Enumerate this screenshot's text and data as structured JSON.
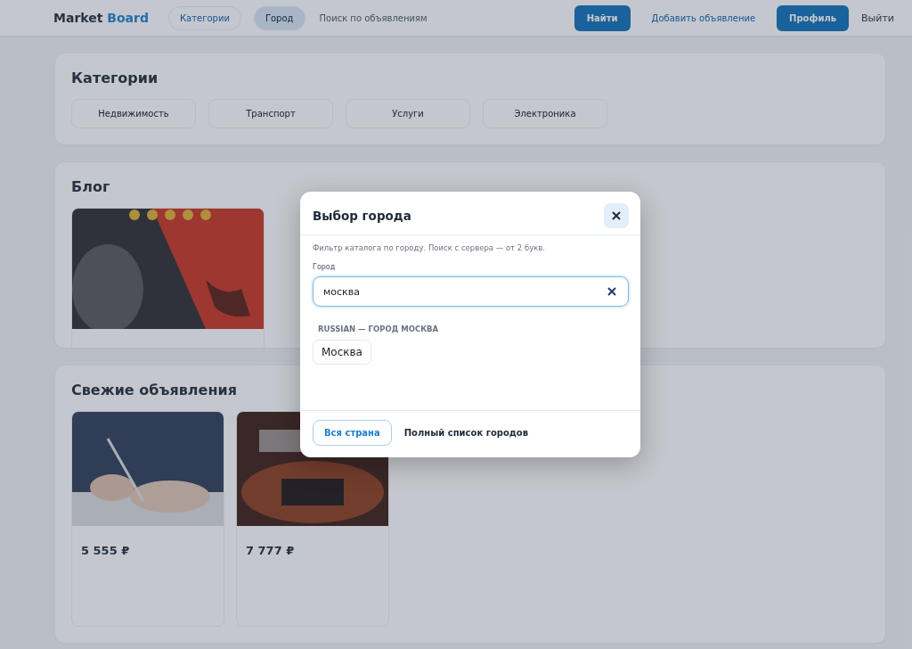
{
  "header": {
    "logo_first": "Market",
    "logo_second": "Board",
    "nav": [
      {
        "label": "Категории",
        "selected": false
      },
      {
        "label": "Город",
        "selected": true
      }
    ],
    "search": {
      "placeholder": "Поиск по объявлениям"
    },
    "search_button": "Найти",
    "add_link": "Добавить объявление",
    "profile_button": "Профиль",
    "logout": "Выйти"
  },
  "categories": {
    "title": "Категории",
    "items": [
      "Недвижимость",
      "Транспорт",
      "Услуги",
      "Электроника"
    ]
  },
  "blog": {
    "title": "Блог"
  },
  "listings": {
    "title": "Свежие объявления",
    "items": [
      {
        "price": "5 555 ₽"
      },
      {
        "price": "7 777 ₽"
      }
    ]
  },
  "modal": {
    "title": "Выбор города",
    "hint": "Фильтр каталога по городу. Поиск с сервера — от 2 букв.",
    "field_label": "Город",
    "value": "москва",
    "group": "RUSSIAN — ГОРОД МОСКВА",
    "results": [
      "Москва"
    ],
    "country_button": "Вся страна",
    "full_list_link": "Полный список городов"
  }
}
